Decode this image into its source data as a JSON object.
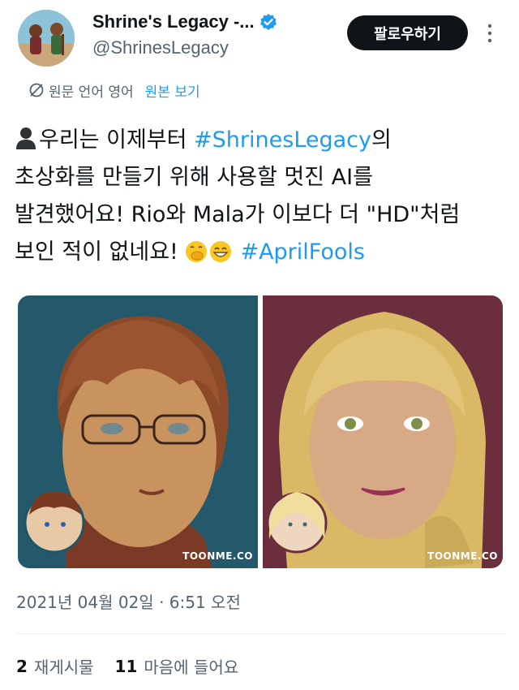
{
  "profile": {
    "display_name": "Shrine's Legacy -...",
    "handle": "@ShrinesLegacy",
    "verified_icon": "verified-badge-icon",
    "follow_label": "팔로우하기",
    "more_icon": "more-vertical-icon"
  },
  "translate": {
    "meta": "원문 언어 영어",
    "link": "원본 보기",
    "icon": "globe-icon"
  },
  "tweet": {
    "line1_a": "우리는 이제부터 ",
    "line1_tag": "#ShrinesLegacy",
    "line1_b": "의",
    "line2": "초상화를 만들기 위해 사용할 멋진 AI를",
    "line3": "발견했어요! Rio와 Mala가 이보다 더 \"HD\"처럼",
    "line4_a": "보인 적이 없네요! ",
    "line4_tag": "#AprilFools"
  },
  "media": {
    "left_watermark": "TOONME.CO",
    "right_watermark": "TOONME.CO"
  },
  "meta": {
    "timestamp": "2021년 04월 02일 · 6:51 오전"
  },
  "stats": {
    "retweets_count": "2",
    "retweets_label": "재게시물",
    "likes_count": "11",
    "likes_label": "마음에 들어요"
  },
  "colors": {
    "accent": "#1d9bf0",
    "text": "#0f1419",
    "muted": "#536471"
  }
}
